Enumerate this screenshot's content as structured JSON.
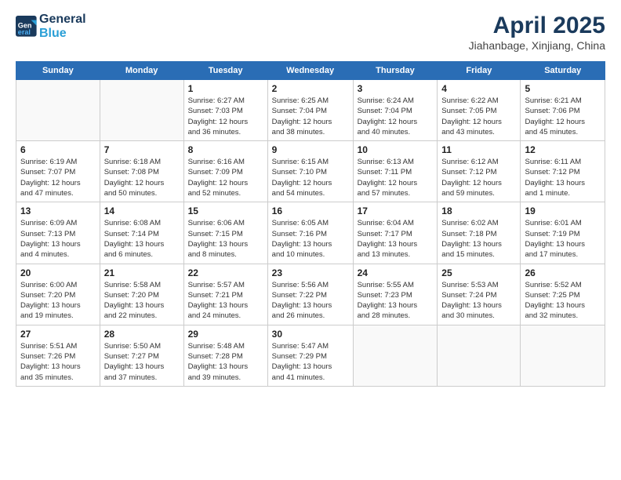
{
  "header": {
    "logo_line1": "General",
    "logo_line2": "Blue",
    "month": "April 2025",
    "location": "Jiahanbage, Xinjiang, China"
  },
  "weekdays": [
    "Sunday",
    "Monday",
    "Tuesday",
    "Wednesday",
    "Thursday",
    "Friday",
    "Saturday"
  ],
  "weeks": [
    [
      {
        "day": "",
        "info": ""
      },
      {
        "day": "",
        "info": ""
      },
      {
        "day": "1",
        "info": "Sunrise: 6:27 AM\nSunset: 7:03 PM\nDaylight: 12 hours\nand 36 minutes."
      },
      {
        "day": "2",
        "info": "Sunrise: 6:25 AM\nSunset: 7:04 PM\nDaylight: 12 hours\nand 38 minutes."
      },
      {
        "day": "3",
        "info": "Sunrise: 6:24 AM\nSunset: 7:04 PM\nDaylight: 12 hours\nand 40 minutes."
      },
      {
        "day": "4",
        "info": "Sunrise: 6:22 AM\nSunset: 7:05 PM\nDaylight: 12 hours\nand 43 minutes."
      },
      {
        "day": "5",
        "info": "Sunrise: 6:21 AM\nSunset: 7:06 PM\nDaylight: 12 hours\nand 45 minutes."
      }
    ],
    [
      {
        "day": "6",
        "info": "Sunrise: 6:19 AM\nSunset: 7:07 PM\nDaylight: 12 hours\nand 47 minutes."
      },
      {
        "day": "7",
        "info": "Sunrise: 6:18 AM\nSunset: 7:08 PM\nDaylight: 12 hours\nand 50 minutes."
      },
      {
        "day": "8",
        "info": "Sunrise: 6:16 AM\nSunset: 7:09 PM\nDaylight: 12 hours\nand 52 minutes."
      },
      {
        "day": "9",
        "info": "Sunrise: 6:15 AM\nSunset: 7:10 PM\nDaylight: 12 hours\nand 54 minutes."
      },
      {
        "day": "10",
        "info": "Sunrise: 6:13 AM\nSunset: 7:11 PM\nDaylight: 12 hours\nand 57 minutes."
      },
      {
        "day": "11",
        "info": "Sunrise: 6:12 AM\nSunset: 7:12 PM\nDaylight: 12 hours\nand 59 minutes."
      },
      {
        "day": "12",
        "info": "Sunrise: 6:11 AM\nSunset: 7:12 PM\nDaylight: 13 hours\nand 1 minute."
      }
    ],
    [
      {
        "day": "13",
        "info": "Sunrise: 6:09 AM\nSunset: 7:13 PM\nDaylight: 13 hours\nand 4 minutes."
      },
      {
        "day": "14",
        "info": "Sunrise: 6:08 AM\nSunset: 7:14 PM\nDaylight: 13 hours\nand 6 minutes."
      },
      {
        "day": "15",
        "info": "Sunrise: 6:06 AM\nSunset: 7:15 PM\nDaylight: 13 hours\nand 8 minutes."
      },
      {
        "day": "16",
        "info": "Sunrise: 6:05 AM\nSunset: 7:16 PM\nDaylight: 13 hours\nand 10 minutes."
      },
      {
        "day": "17",
        "info": "Sunrise: 6:04 AM\nSunset: 7:17 PM\nDaylight: 13 hours\nand 13 minutes."
      },
      {
        "day": "18",
        "info": "Sunrise: 6:02 AM\nSunset: 7:18 PM\nDaylight: 13 hours\nand 15 minutes."
      },
      {
        "day": "19",
        "info": "Sunrise: 6:01 AM\nSunset: 7:19 PM\nDaylight: 13 hours\nand 17 minutes."
      }
    ],
    [
      {
        "day": "20",
        "info": "Sunrise: 6:00 AM\nSunset: 7:20 PM\nDaylight: 13 hours\nand 19 minutes."
      },
      {
        "day": "21",
        "info": "Sunrise: 5:58 AM\nSunset: 7:20 PM\nDaylight: 13 hours\nand 22 minutes."
      },
      {
        "day": "22",
        "info": "Sunrise: 5:57 AM\nSunset: 7:21 PM\nDaylight: 13 hours\nand 24 minutes."
      },
      {
        "day": "23",
        "info": "Sunrise: 5:56 AM\nSunset: 7:22 PM\nDaylight: 13 hours\nand 26 minutes."
      },
      {
        "day": "24",
        "info": "Sunrise: 5:55 AM\nSunset: 7:23 PM\nDaylight: 13 hours\nand 28 minutes."
      },
      {
        "day": "25",
        "info": "Sunrise: 5:53 AM\nSunset: 7:24 PM\nDaylight: 13 hours\nand 30 minutes."
      },
      {
        "day": "26",
        "info": "Sunrise: 5:52 AM\nSunset: 7:25 PM\nDaylight: 13 hours\nand 32 minutes."
      }
    ],
    [
      {
        "day": "27",
        "info": "Sunrise: 5:51 AM\nSunset: 7:26 PM\nDaylight: 13 hours\nand 35 minutes."
      },
      {
        "day": "28",
        "info": "Sunrise: 5:50 AM\nSunset: 7:27 PM\nDaylight: 13 hours\nand 37 minutes."
      },
      {
        "day": "29",
        "info": "Sunrise: 5:48 AM\nSunset: 7:28 PM\nDaylight: 13 hours\nand 39 minutes."
      },
      {
        "day": "30",
        "info": "Sunrise: 5:47 AM\nSunset: 7:29 PM\nDaylight: 13 hours\nand 41 minutes."
      },
      {
        "day": "",
        "info": ""
      },
      {
        "day": "",
        "info": ""
      },
      {
        "day": "",
        "info": ""
      }
    ]
  ]
}
